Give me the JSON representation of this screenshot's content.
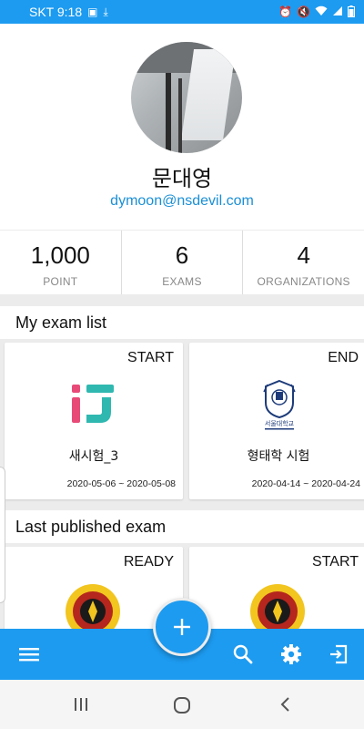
{
  "status_bar": {
    "carrier_time": "SKT 9:18",
    "battery": "▮"
  },
  "profile": {
    "name": "문대영",
    "email": "dymoon@nsdevil.com"
  },
  "stats": [
    {
      "value": "1,000",
      "label": "POINT"
    },
    {
      "value": "6",
      "label": "EXAMS"
    },
    {
      "value": "4",
      "label": "ORGANIZATIONS"
    }
  ],
  "sections": {
    "my_exam_list": "My exam list",
    "last_published": "Last published exam"
  },
  "my_exams": [
    {
      "status": "START",
      "title": "새시험_3",
      "date": "2020-05-06 ~ 2020-05-08",
      "logo": "ij-logo"
    },
    {
      "status": "END",
      "title": "형태학 시험",
      "date": "2020-04-14 ~ 2020-04-24",
      "logo": "seoul-university-seal"
    }
  ],
  "published_exams": [
    {
      "status": "READY",
      "logo": "universitas-seal"
    },
    {
      "status": "START",
      "logo": "universitas-seal"
    }
  ],
  "seal_text": "서울대학교",
  "colors": {
    "primary": "#1d9bf0",
    "email": "#1a8fd6",
    "ij_teal": "#2fb8b0",
    "ij_pink": "#e84a78"
  },
  "bottom_bar": {
    "icons": [
      "menu-icon",
      "add-icon",
      "search-icon",
      "gear-icon",
      "logout-icon"
    ]
  },
  "nav_bar": {
    "icons": [
      "recent-apps-icon",
      "home-icon",
      "back-icon"
    ]
  }
}
